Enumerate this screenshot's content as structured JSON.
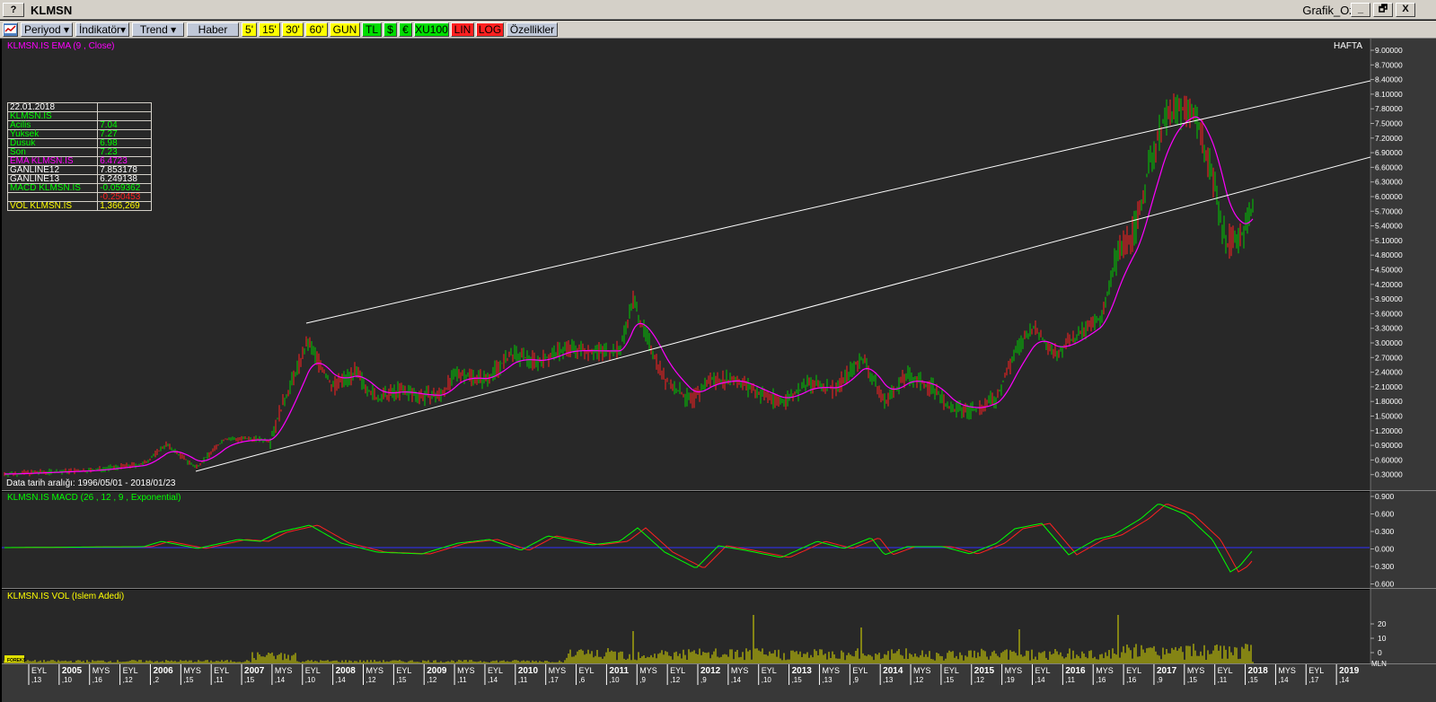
{
  "window": {
    "help_label": "?",
    "title": "KLMSN",
    "right_title": "Grafik_Ozel",
    "minimize": "_",
    "restore": "🗗",
    "close": "X"
  },
  "toolbar": {
    "periyod": "Periyod",
    "indikator": "İndikatör",
    "trend": "Trend",
    "haber": "Haber",
    "p5": "5'",
    "p15": "15'",
    "p30": "30'",
    "p60": "60'",
    "gun": "GUN",
    "tl": "TL",
    "usd": "$",
    "eur": "€",
    "xu100": "XU100",
    "lin": "LIN",
    "log": "LOG",
    "ozellikler": "Özellikler"
  },
  "price_panel": {
    "title": "KLMSN.IS EMA (9 , Close)",
    "period_label": "HAFTA",
    "date_range": "Data tarih aralığı: 1996/05/01 - 2018/01/23",
    "y_ticks": [
      "9.00000",
      "8.70000",
      "8.40000",
      "8.10000",
      "7.80000",
      "7.50000",
      "7.20000",
      "6.90000",
      "6.60000",
      "6.30000",
      "6.00000",
      "5.70000",
      "5.40000",
      "5.10000",
      "4.80000",
      "4.50000",
      "4.20000",
      "3.90000",
      "3.60000",
      "3.30000",
      "3.00000",
      "2.70000",
      "2.40000",
      "2.10000",
      "1.80000",
      "1.50000",
      "1.20000",
      "0.90000",
      "0.60000",
      "0.30000"
    ]
  },
  "info_box": {
    "date": "22.01.2018",
    "symbol": "KLMSN.IS",
    "rows": [
      {
        "label": "Acilis",
        "value": "7.04"
      },
      {
        "label": "Yuksek",
        "value": "7.27"
      },
      {
        "label": "Dusuk",
        "value": "6.98"
      },
      {
        "label": "Son",
        "value": "7.23"
      },
      {
        "label": "EMA KLMSN.IS",
        "value": "6.4723"
      },
      {
        "label": "GANLINE12",
        "value": "7.853178"
      },
      {
        "label": "GANLINE13",
        "value": "6.249138"
      },
      {
        "label": "MACD KLMSN.IS",
        "value": "-0.059362"
      },
      {
        "label": "",
        "value": "-0.250453"
      },
      {
        "label": "VOL KLMSN.IS",
        "value": "1,366,269"
      }
    ]
  },
  "macd_panel": {
    "title": "KLMSN.IS MACD (26 , 12 , 9 , Exponential)",
    "y_ticks": [
      "0.900",
      "0.600",
      "0.300",
      "0.000",
      "0.300",
      "0.600"
    ]
  },
  "vol_panel": {
    "title": "KLMSN.IS VOL (Islem Adedi)",
    "y_ticks": [
      "20",
      "10",
      "0"
    ],
    "unit": "MLN",
    "logo": "FOREKS"
  },
  "x_axis": {
    "labels": [
      [
        "EYL",
        "13"
      ],
      [
        "2005",
        "10"
      ],
      [
        "MYS",
        "16"
      ],
      [
        "EYL",
        "12"
      ],
      [
        "2006",
        "2"
      ],
      [
        "MYS",
        "15"
      ],
      [
        "EYL",
        "11"
      ],
      [
        "2007",
        "15"
      ],
      [
        "MYS",
        "14"
      ],
      [
        "EYL",
        "10"
      ],
      [
        "2008",
        "14"
      ],
      [
        "MYS",
        "12"
      ],
      [
        "EYL",
        "15"
      ],
      [
        "2009",
        "12"
      ],
      [
        "MYS",
        "11"
      ],
      [
        "EYL",
        "14"
      ],
      [
        "2010",
        "11"
      ],
      [
        "MYS",
        "17"
      ],
      [
        "EYL",
        "6"
      ],
      [
        "2011",
        "10"
      ],
      [
        "MYS",
        "9"
      ],
      [
        "EYL",
        "12"
      ],
      [
        "2012",
        "9"
      ],
      [
        "MYS",
        "14"
      ],
      [
        "EYL",
        "10"
      ],
      [
        "2013",
        "15"
      ],
      [
        "MYS",
        "13"
      ],
      [
        "EYL",
        "9"
      ],
      [
        "2014",
        "13"
      ],
      [
        "MYS",
        "12"
      ],
      [
        "EYL",
        "15"
      ],
      [
        "2015",
        "12"
      ],
      [
        "MYS",
        "19"
      ],
      [
        "EYL",
        "14"
      ],
      [
        "2016",
        "11"
      ],
      [
        "MYS",
        "16"
      ],
      [
        "EYL",
        "16"
      ],
      [
        "2017",
        "9"
      ],
      [
        "MYS",
        "15"
      ],
      [
        "EYL",
        "11"
      ],
      [
        "2018",
        "15"
      ],
      [
        "MYS",
        "14"
      ],
      [
        "EYL",
        "17"
      ],
      [
        "2019",
        "14"
      ]
    ]
  },
  "colors": {
    "price_bar_up": "#00cc00",
    "price_bar_down": "#ff2020",
    "ema_line": "#ff00ff",
    "gann_lines": "#ffffff",
    "macd_line": "#00ff00",
    "signal_line": "#ff2020",
    "zero_line": "#3030ff",
    "volume_bar": "#e0e000"
  }
}
